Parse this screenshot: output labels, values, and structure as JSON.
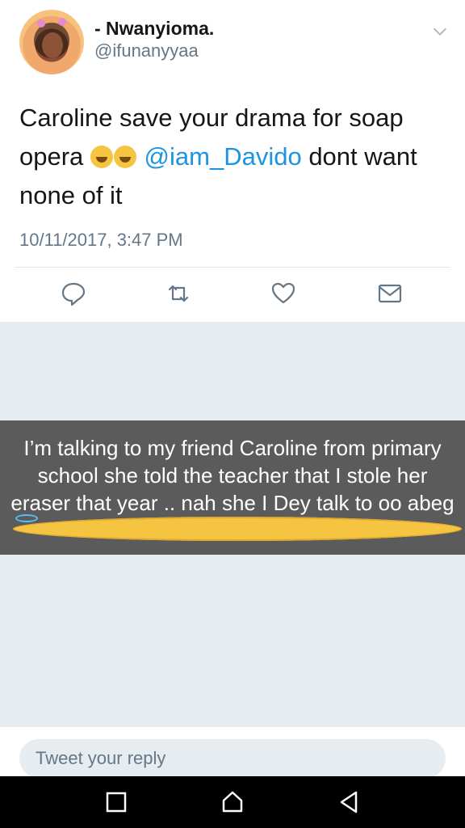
{
  "tweet": {
    "display_name": "- Nwanyioma.",
    "handle": "@ifunanyyaa",
    "text_part1": "Caroline save your drama for soap opera ",
    "text_mention": "@iam_Davido",
    "text_part2": " dont want none of it",
    "timestamp": "10/11/2017, 3:47 PM",
    "mention_color": "#1b95e0"
  },
  "actions": {
    "reply_icon": "reply-icon",
    "retweet_icon": "retweet-icon",
    "like_icon": "heart-icon",
    "message_icon": "envelope-icon"
  },
  "caption": {
    "text": "I’m talking to my friend Caroline from primary school she told the teacher that I stole her eraser that year ..  nah she I Dey talk to oo abeg"
  },
  "reply": {
    "placeholder": "Tweet your reply"
  },
  "nav": {
    "recent_icon": "square-icon",
    "home_icon": "home-icon",
    "back_icon": "back-triangle-icon"
  }
}
